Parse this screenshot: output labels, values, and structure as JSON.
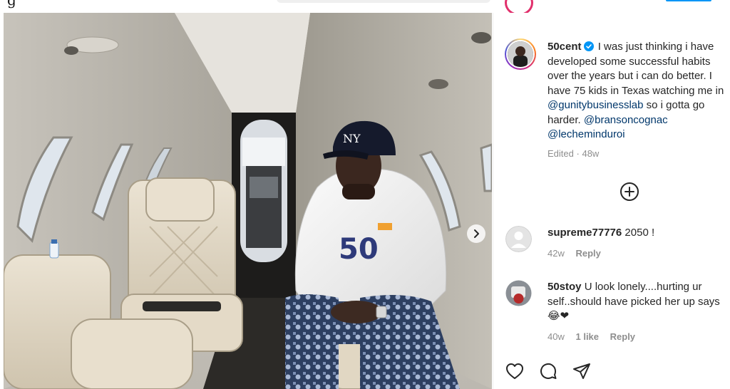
{
  "top": {
    "logo_fragment": "g"
  },
  "post": {
    "author": "50cent",
    "caption_text": "I was just thinking i have developed some successful habits over the years but i can do better. I have 75 kids in Texas watching me in",
    "mention_1": "@gunitybusinesslab",
    "caption_mid": "so i gotta go harder.",
    "mention_2": "@bransoncognac",
    "mention_3": "@lecheminduroi",
    "edited_label": "Edited",
    "separator": "·",
    "age": "48w",
    "photo_jersey_text": "50"
  },
  "comments": [
    {
      "user": "supreme77776",
      "text": "2050 !",
      "age": "42w",
      "reply_label": "Reply"
    },
    {
      "user": "50stoy",
      "text": "U look lonely....hurting ur",
      "text_line2": "self..should have picked her up says",
      "emoji": "😂❤",
      "age": "40w",
      "likes": "1 like",
      "reply_label": "Reply"
    }
  ],
  "colors": {
    "mention": "#00376b",
    "meta": "#8e8e8e",
    "verified": "#0095f6",
    "text": "#262626"
  },
  "icons": [
    "verified-badge-icon",
    "load-more-comments-icon",
    "carousel-next-icon",
    "heart-icon",
    "comment-icon",
    "share-icon"
  ]
}
